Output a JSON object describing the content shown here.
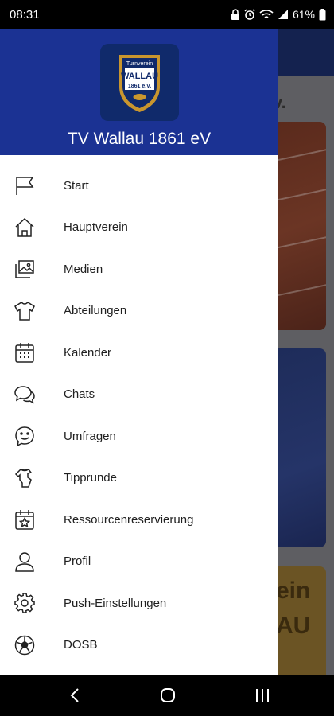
{
  "status_bar": {
    "time": "08:31",
    "battery": "61%"
  },
  "drawer": {
    "app_name": "TV Wallau 1861 eV",
    "logo": {
      "top_text": "Turnverein",
      "main_text": "WALLAU",
      "sub_text": "1861 e.V."
    },
    "items": [
      {
        "label": "Start",
        "icon": "flag-icon"
      },
      {
        "label": "Hauptverein",
        "icon": "home-icon"
      },
      {
        "label": "Medien",
        "icon": "media-icon"
      },
      {
        "label": "Abteilungen",
        "icon": "shirt-icon"
      },
      {
        "label": "Kalender",
        "icon": "calendar-icon"
      },
      {
        "label": "Chats",
        "icon": "chats-icon"
      },
      {
        "label": "Umfragen",
        "icon": "smiley-icon"
      },
      {
        "label": "Tipprunde",
        "icon": "soccer-jersey-icon"
      },
      {
        "label": "Ressourcenreservierung",
        "icon": "calendar-star-icon"
      },
      {
        "label": "Profil",
        "icon": "person-icon"
      },
      {
        "label": "Push-Einstellungen",
        "icon": "gear-icon"
      },
      {
        "label": "DOSB",
        "icon": "soccer-ball-icon"
      }
    ]
  },
  "background": {
    "title_fragment": "v.",
    "card3_line1": "ein",
    "card3_line2": "AU"
  },
  "colors": {
    "header_blue": "#1b3293",
    "logo_gold": "#c9962e",
    "logo_navy": "#102a6b"
  }
}
